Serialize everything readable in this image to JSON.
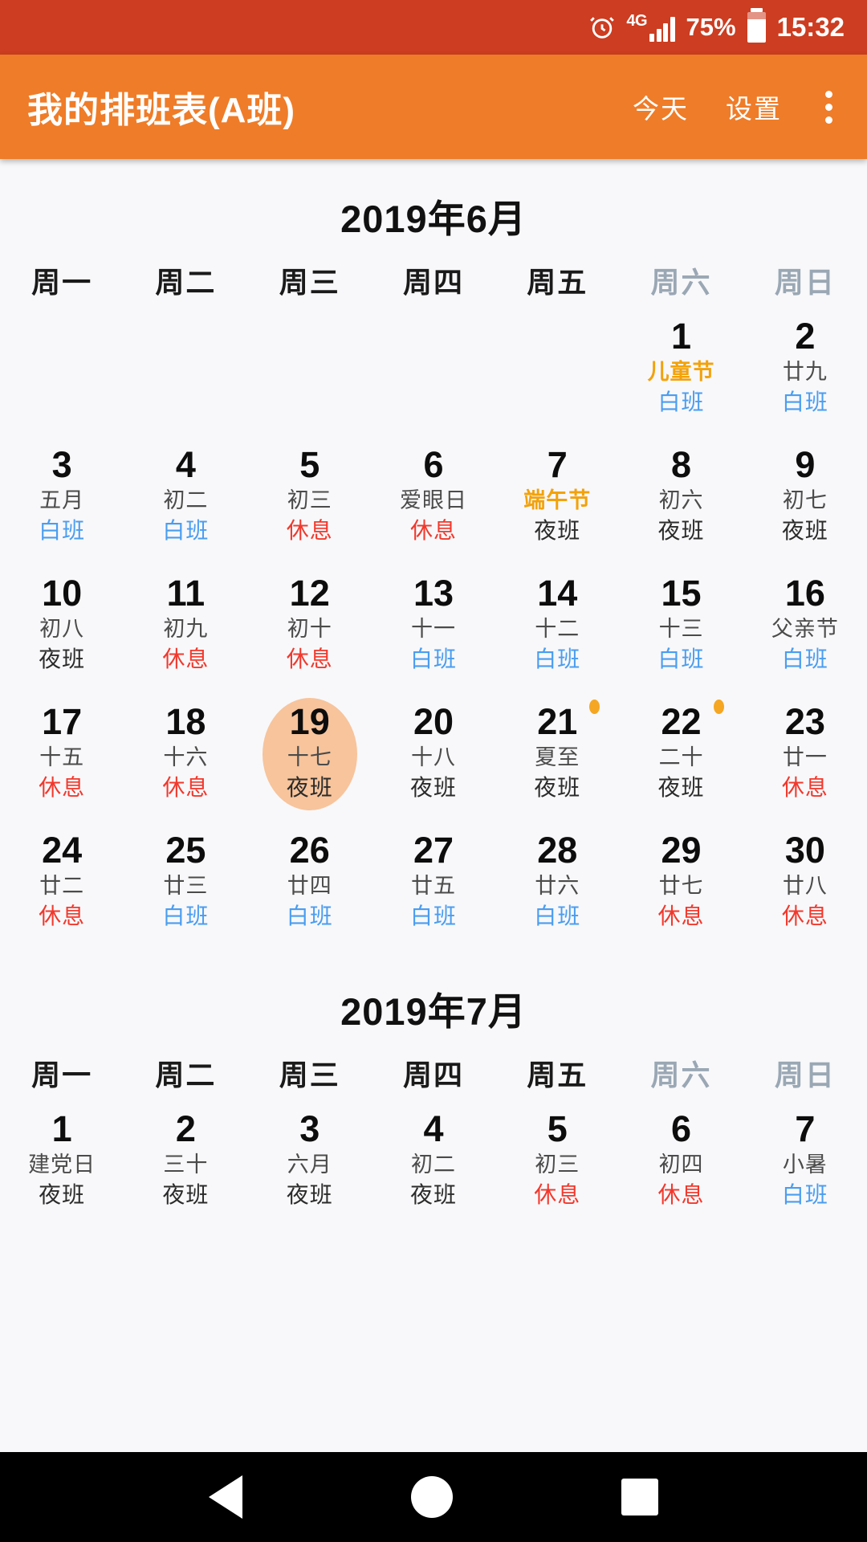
{
  "status_bar": {
    "alarm_icon": "alarm-clock-icon",
    "network_type": "4G",
    "signal_icon": "signal-bars-icon",
    "battery_percent": "75%",
    "battery_icon": "battery-icon",
    "time": "15:32"
  },
  "app_bar": {
    "title": "我的排班表(A班)",
    "today_label": "今天",
    "settings_label": "设置",
    "overflow_icon": "overflow-menu-icon"
  },
  "colors": {
    "status_bar_bg": "#cc3d21",
    "app_bar_bg": "#ef7c28",
    "page_bg": "#f8f8fa",
    "day_shift": "#4a9df0",
    "rest_shift": "#f2382c",
    "night_shift": "#2b2b2b",
    "festival": "#f2a20c",
    "weekend_header": "#9aa7b4",
    "today_highlight": "#f7c49c",
    "event_dot": "#f5a623"
  },
  "weekday_headers": [
    {
      "label": "周一",
      "weekend": false
    },
    {
      "label": "周二",
      "weekend": false
    },
    {
      "label": "周三",
      "weekend": false
    },
    {
      "label": "周四",
      "weekend": false
    },
    {
      "label": "周五",
      "weekend": false
    },
    {
      "label": "周六",
      "weekend": true
    },
    {
      "label": "周日",
      "weekend": true
    }
  ],
  "months": [
    {
      "title": "2019年6月",
      "lead_blank": 5,
      "days": [
        {
          "day": "1",
          "lunar": "儿童节",
          "festival": true,
          "shift": "白班",
          "shift_type": "day"
        },
        {
          "day": "2",
          "lunar": "廿九",
          "festival": false,
          "shift": "白班",
          "shift_type": "day"
        },
        {
          "day": "3",
          "lunar": "五月",
          "festival": false,
          "shift": "白班",
          "shift_type": "day"
        },
        {
          "day": "4",
          "lunar": "初二",
          "festival": false,
          "shift": "白班",
          "shift_type": "day"
        },
        {
          "day": "5",
          "lunar": "初三",
          "festival": false,
          "shift": "休息",
          "shift_type": "rest"
        },
        {
          "day": "6",
          "lunar": "爱眼日",
          "festival": false,
          "shift": "休息",
          "shift_type": "rest"
        },
        {
          "day": "7",
          "lunar": "端午节",
          "festival": true,
          "shift": "夜班",
          "shift_type": "night"
        },
        {
          "day": "8",
          "lunar": "初六",
          "festival": false,
          "shift": "夜班",
          "shift_type": "night"
        },
        {
          "day": "9",
          "lunar": "初七",
          "festival": false,
          "shift": "夜班",
          "shift_type": "night"
        },
        {
          "day": "10",
          "lunar": "初八",
          "festival": false,
          "shift": "夜班",
          "shift_type": "night"
        },
        {
          "day": "11",
          "lunar": "初九",
          "festival": false,
          "shift": "休息",
          "shift_type": "rest"
        },
        {
          "day": "12",
          "lunar": "初十",
          "festival": false,
          "shift": "休息",
          "shift_type": "rest"
        },
        {
          "day": "13",
          "lunar": "十一",
          "festival": false,
          "shift": "白班",
          "shift_type": "day"
        },
        {
          "day": "14",
          "lunar": "十二",
          "festival": false,
          "shift": "白班",
          "shift_type": "day"
        },
        {
          "day": "15",
          "lunar": "十三",
          "festival": false,
          "shift": "白班",
          "shift_type": "day"
        },
        {
          "day": "16",
          "lunar": "父亲节",
          "festival": false,
          "shift": "白班",
          "shift_type": "day"
        },
        {
          "day": "17",
          "lunar": "十五",
          "festival": false,
          "shift": "休息",
          "shift_type": "rest"
        },
        {
          "day": "18",
          "lunar": "十六",
          "festival": false,
          "shift": "休息",
          "shift_type": "rest"
        },
        {
          "day": "19",
          "lunar": "十七",
          "festival": false,
          "shift": "夜班",
          "shift_type": "night",
          "today": true
        },
        {
          "day": "20",
          "lunar": "十八",
          "festival": false,
          "shift": "夜班",
          "shift_type": "night"
        },
        {
          "day": "21",
          "lunar": "夏至",
          "festival": false,
          "shift": "夜班",
          "shift_type": "night",
          "dot": true
        },
        {
          "day": "22",
          "lunar": "二十",
          "festival": false,
          "shift": "夜班",
          "shift_type": "night",
          "dot": true
        },
        {
          "day": "23",
          "lunar": "廿一",
          "festival": false,
          "shift": "休息",
          "shift_type": "rest"
        },
        {
          "day": "24",
          "lunar": "廿二",
          "festival": false,
          "shift": "休息",
          "shift_type": "rest"
        },
        {
          "day": "25",
          "lunar": "廿三",
          "festival": false,
          "shift": "白班",
          "shift_type": "day"
        },
        {
          "day": "26",
          "lunar": "廿四",
          "festival": false,
          "shift": "白班",
          "shift_type": "day"
        },
        {
          "day": "27",
          "lunar": "廿五",
          "festival": false,
          "shift": "白班",
          "shift_type": "day"
        },
        {
          "day": "28",
          "lunar": "廿六",
          "festival": false,
          "shift": "白班",
          "shift_type": "day"
        },
        {
          "day": "29",
          "lunar": "廿七",
          "festival": false,
          "shift": "休息",
          "shift_type": "rest"
        },
        {
          "day": "30",
          "lunar": "廿八",
          "festival": false,
          "shift": "休息",
          "shift_type": "rest"
        }
      ]
    },
    {
      "title": "2019年7月",
      "lead_blank": 0,
      "days": [
        {
          "day": "1",
          "lunar": "建党日",
          "festival": false,
          "shift": "夜班",
          "shift_type": "night"
        },
        {
          "day": "2",
          "lunar": "三十",
          "festival": false,
          "shift": "夜班",
          "shift_type": "night"
        },
        {
          "day": "3",
          "lunar": "六月",
          "festival": false,
          "shift": "夜班",
          "shift_type": "night"
        },
        {
          "day": "4",
          "lunar": "初二",
          "festival": false,
          "shift": "夜班",
          "shift_type": "night"
        },
        {
          "day": "5",
          "lunar": "初三",
          "festival": false,
          "shift": "休息",
          "shift_type": "rest"
        },
        {
          "day": "6",
          "lunar": "初四",
          "festival": false,
          "shift": "休息",
          "shift_type": "rest"
        },
        {
          "day": "7",
          "lunar": "小暑",
          "festival": false,
          "shift": "白班",
          "shift_type": "day"
        }
      ]
    }
  ],
  "nav_bar": {
    "back_icon": "back-triangle-icon",
    "home_icon": "home-circle-icon",
    "recents_icon": "recents-square-icon"
  }
}
